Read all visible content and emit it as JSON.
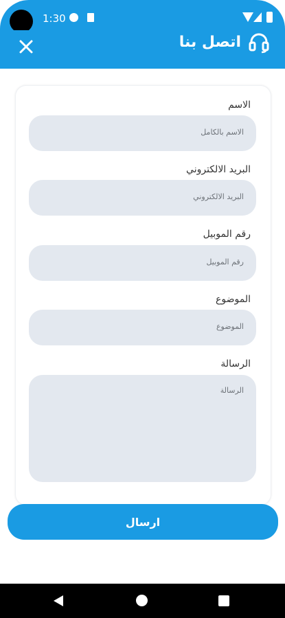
{
  "status_bar": {
    "time": "1:30"
  },
  "header": {
    "title": "اتصل بنا"
  },
  "form": {
    "fields": [
      {
        "label": "الاسم",
        "placeholder": "الاسم بالكامل"
      },
      {
        "label": "البريد الالكتروني",
        "placeholder": "البريد الالكتروني"
      },
      {
        "label": "رقم الموبيل",
        "placeholder": "رقم الموبيل"
      },
      {
        "label": "الموضوع",
        "placeholder": "الموضوع"
      },
      {
        "label": "الرسالة",
        "placeholder": "الرسالة"
      }
    ],
    "submit_label": "ارسال"
  },
  "colors": {
    "primary": "#1a9be3",
    "field_bg": "#e3e8ef"
  },
  "icons": {
    "close": "close-icon",
    "headset": "headset-icon"
  }
}
